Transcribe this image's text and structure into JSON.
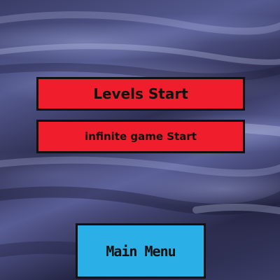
{
  "menu": {
    "levels_start_label": "Levels Start",
    "infinite_start_label": "infinite game Start",
    "main_menu_label": "Main Menu"
  },
  "colors": {
    "start_button_bg": "#f01e2c",
    "main_menu_bg": "#2ab0e6",
    "button_border": "#111111",
    "background": "#3a3d66"
  }
}
